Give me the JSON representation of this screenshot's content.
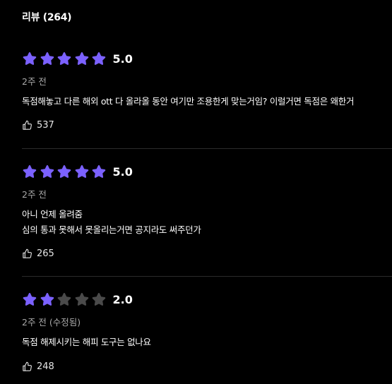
{
  "colors": {
    "background": "#000000",
    "star_filled": "#7b61ff",
    "star_empty": "#4a4a4a",
    "muted_text": "#a9a9a9",
    "divider": "#2b2b2b"
  },
  "reviews_section": {
    "title": "리뷰 (264)"
  },
  "reviews": [
    {
      "rating": 5,
      "score_label": "5.0",
      "date": "2주 전",
      "lines": [
        "독점해놓고 다른 해외 ott 다 올라올 동안 여기만 조용한게 맞는거임? 이럴거면 독점은 왜한거"
      ],
      "likes": "537",
      "like_icon": "thumbs-up-icon"
    },
    {
      "rating": 5,
      "score_label": "5.0",
      "date": "2주 전",
      "lines": [
        "아니 언제 올려줌",
        "심의 통과 못해서 못올리는거면 공지라도 써주던가"
      ],
      "likes": "265",
      "like_icon": "thumbs-up-icon"
    },
    {
      "rating": 2,
      "score_label": "2.0",
      "date": "2주 전 (수정됨)",
      "lines": [
        "독점 해제시키는 해피 도구는 없나요"
      ],
      "likes": "248",
      "like_icon": "thumbs-up-icon"
    }
  ]
}
